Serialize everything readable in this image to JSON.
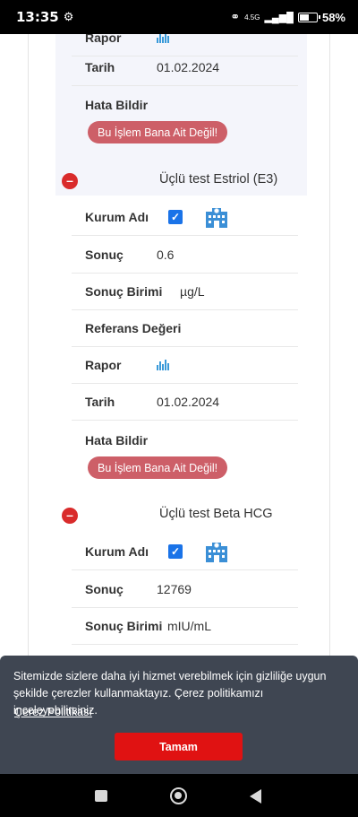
{
  "status_bar": {
    "time": "13:35",
    "battery_percent": "58%",
    "battery_level": 0.58,
    "network": "4.5G"
  },
  "top_partial": {
    "report_label": "Rapor",
    "date_label": "Tarih",
    "date_value": "01.02.2024",
    "error_label": "Hata Bildir",
    "error_button": "Bu İşlem Bana Ait Değil!"
  },
  "sections": [
    {
      "title": "Üçlü test Estriol (E3)",
      "institution_label": "Kurum Adı",
      "result_label": "Sonuç",
      "result_value": "0.6",
      "unit_label": "Sonuç Birimi",
      "unit_value": "µg/L",
      "reference_label": "Referans Değeri",
      "report_label": "Rapor",
      "date_label": "Tarih",
      "date_value": "01.02.2024",
      "error_label": "Hata Bildir",
      "error_button": "Bu İşlem Bana Ait Değil!"
    },
    {
      "title": "Üçlü test Beta HCG",
      "institution_label": "Kurum Adı",
      "result_label": "Sonuç",
      "result_value": "12769",
      "unit_label": "Sonuç Birimi",
      "unit_value": "mIU/mL"
    }
  ],
  "cookie": {
    "message": "Sitemizde sizlere daha iyi hizmet verebilmek için gizliliğe uygun şekilde çerezler kullanmaktayız. Çerez politikamızı inceleyebilirsiniz.",
    "policy_link": "Çerez Politikası",
    "accept_button": "Tamam"
  },
  "colors": {
    "accent_blue": "#1a73e8",
    "error_button": "#cd5f68",
    "collapse_red": "#d92b2b",
    "cookie_bg": "#3f4652",
    "accept_red": "#e01212"
  }
}
